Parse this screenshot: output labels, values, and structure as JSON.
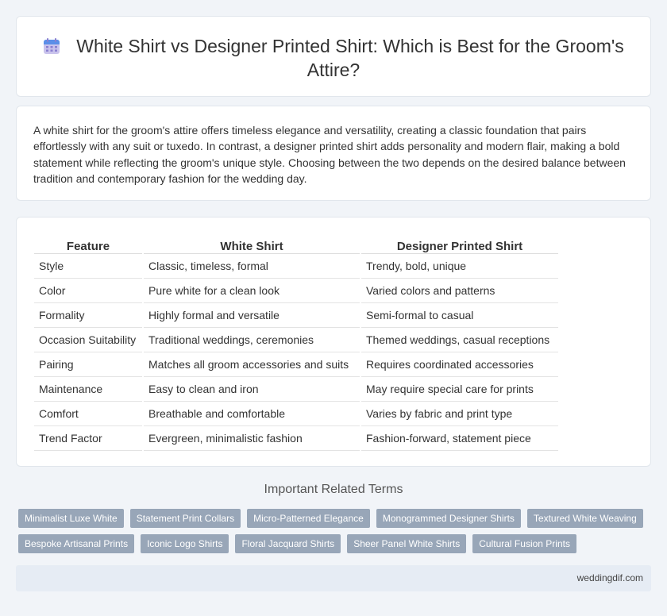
{
  "header": {
    "title": "White Shirt vs Designer Printed Shirt: Which is Best for the Groom's Attire?",
    "icon": "calendar-icon"
  },
  "intro": "A white shirt for the groom's attire offers timeless elegance and versatility, creating a classic foundation that pairs effortlessly with any suit or tuxedo. In contrast, a designer printed shirt adds personality and modern flair, making a bold statement while reflecting the groom's unique style. Choosing between the two depends on the desired balance between tradition and contemporary fashion for the wedding day.",
  "table": {
    "headers": [
      "Feature",
      "White Shirt",
      "Designer Printed Shirt"
    ],
    "rows": [
      [
        "Style",
        "Classic, timeless, formal",
        "Trendy, bold, unique"
      ],
      [
        "Color",
        "Pure white for a clean look",
        "Varied colors and patterns"
      ],
      [
        "Formality",
        "Highly formal and versatile",
        "Semi-formal to casual"
      ],
      [
        "Occasion Suitability",
        "Traditional weddings, ceremonies",
        "Themed weddings, casual receptions"
      ],
      [
        "Pairing",
        "Matches all groom accessories and suits",
        "Requires coordinated accessories"
      ],
      [
        "Maintenance",
        "Easy to clean and iron",
        "May require special care for prints"
      ],
      [
        "Comfort",
        "Breathable and comfortable",
        "Varies by fabric and print type"
      ],
      [
        "Trend Factor",
        "Evergreen, minimalistic fashion",
        "Fashion-forward, statement piece"
      ]
    ]
  },
  "related": {
    "title": "Important Related Terms",
    "tags_row1": [
      "Minimalist Luxe White",
      "Statement Print Collars",
      "Micro-Patterned Elegance",
      "Monogrammed Designer Shirts",
      "Textured White Weaving"
    ],
    "tags_row2": [
      "Bespoke Artisanal Prints",
      "Iconic Logo Shirts",
      "Floral Jacquard Shirts",
      "Sheer Panel White Shirts",
      "Cultural Fusion Prints"
    ]
  },
  "footer": {
    "site": "weddingdif.com"
  },
  "colors": {
    "background": "#f1f4f8",
    "tag_bg": "#98a6b8",
    "footer_bg": "#e6ecf4"
  }
}
